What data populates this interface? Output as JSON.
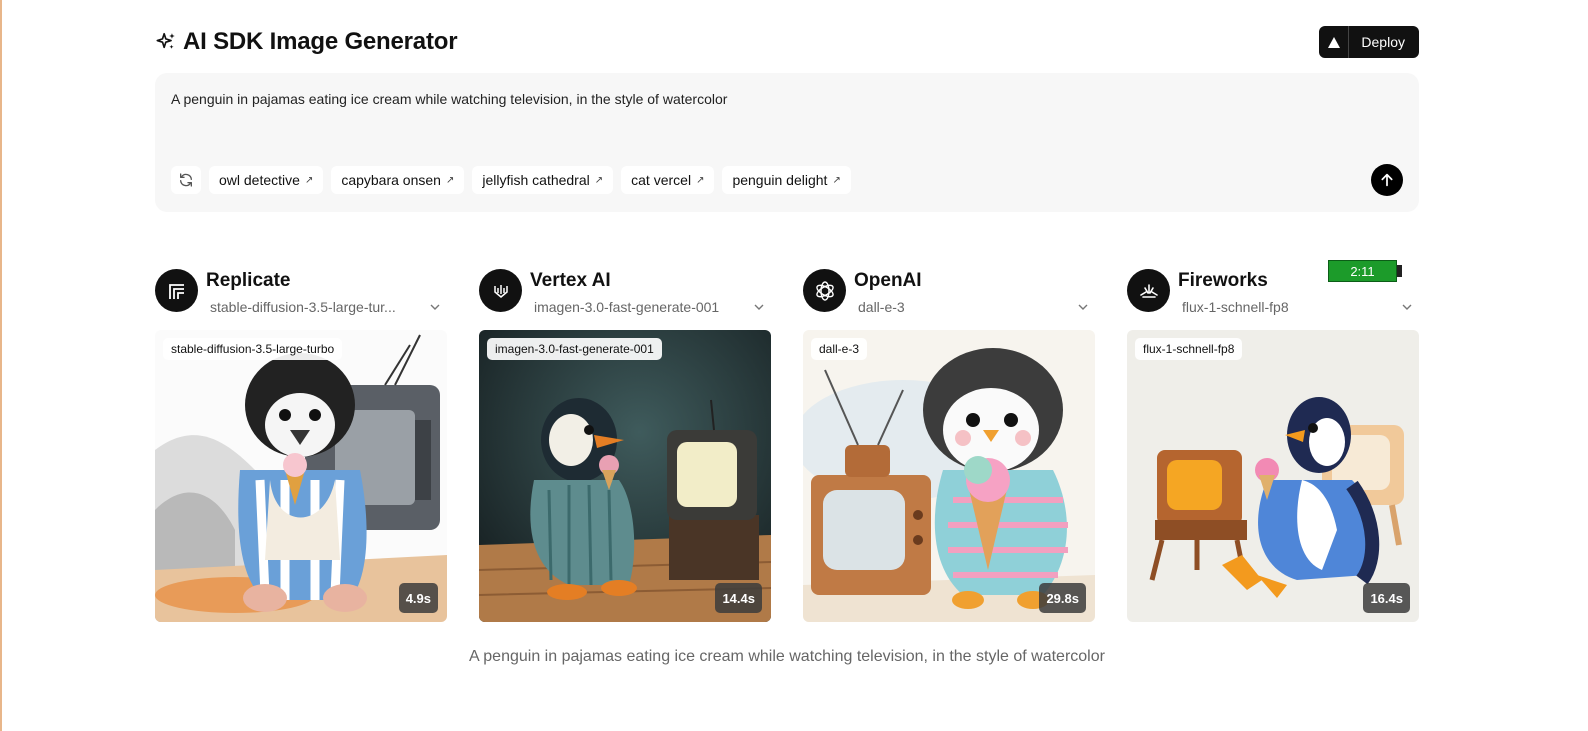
{
  "header": {
    "title": "AI SDK Image Generator",
    "deploy_label": "Deploy"
  },
  "prompt": {
    "value": "A penguin in pajamas eating ice cream while watching television, in the style of watercolor"
  },
  "suggestions": [
    {
      "label": "owl detective"
    },
    {
      "label": "capybara onsen"
    },
    {
      "label": "jellyfish cathedral"
    },
    {
      "label": "cat vercel"
    },
    {
      "label": "penguin delight"
    }
  ],
  "timer": "2:11",
  "providers": [
    {
      "name": "Replicate",
      "model": "stable-diffusion-3.5-large-tur...",
      "badge": "stable-diffusion-3.5-large-turbo",
      "time": "4.9s",
      "icon": "replicate-icon"
    },
    {
      "name": "Vertex AI",
      "model": "imagen-3.0-fast-generate-001",
      "badge": "imagen-3.0-fast-generate-001",
      "time": "14.4s",
      "icon": "vertex-ai-icon"
    },
    {
      "name": "OpenAI",
      "model": "dall-e-3",
      "badge": "dall-e-3",
      "time": "29.8s",
      "icon": "openai-icon"
    },
    {
      "name": "Fireworks",
      "model": "flux-1-schnell-fp8",
      "badge": "flux-1-schnell-fp8",
      "time": "16.4s",
      "icon": "fireworks-icon"
    }
  ],
  "caption": "A penguin in pajamas eating ice cream while watching television, in the style of watercolor",
  "icons": {
    "title": "sparkles-icon",
    "deploy": "triangle-icon",
    "refresh": "refresh-icon",
    "send": "arrow-up-icon",
    "chip": "arrow-up-right-icon",
    "select": "chevron-down-icon"
  }
}
